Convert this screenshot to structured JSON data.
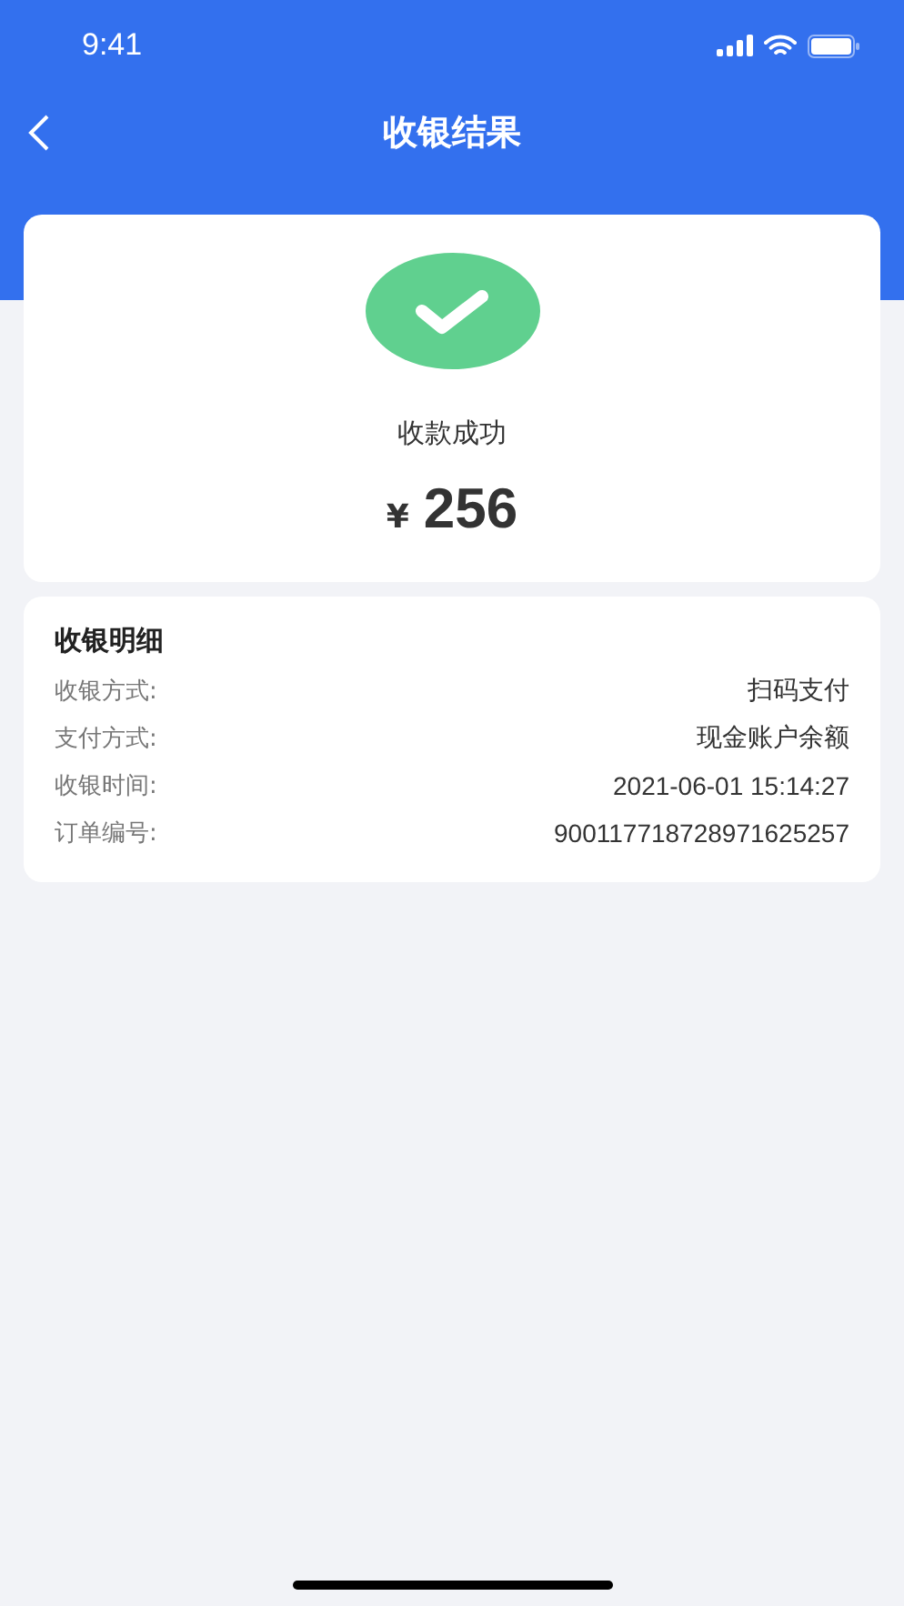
{
  "status_bar": {
    "time": "9:41"
  },
  "nav": {
    "title": "收银结果"
  },
  "result": {
    "status": "收款成功",
    "currency": "¥",
    "amount": "256"
  },
  "details": {
    "title": "收银明细",
    "rows": [
      {
        "label": "收银方式:",
        "value": "扫码支付"
      },
      {
        "label": "支付方式:",
        "value": "现金账户余额"
      },
      {
        "label": "收银时间:",
        "value": "2021-06-01 15:14:27"
      },
      {
        "label": "订单编号:",
        "value": "900117718728971625257"
      }
    ]
  }
}
